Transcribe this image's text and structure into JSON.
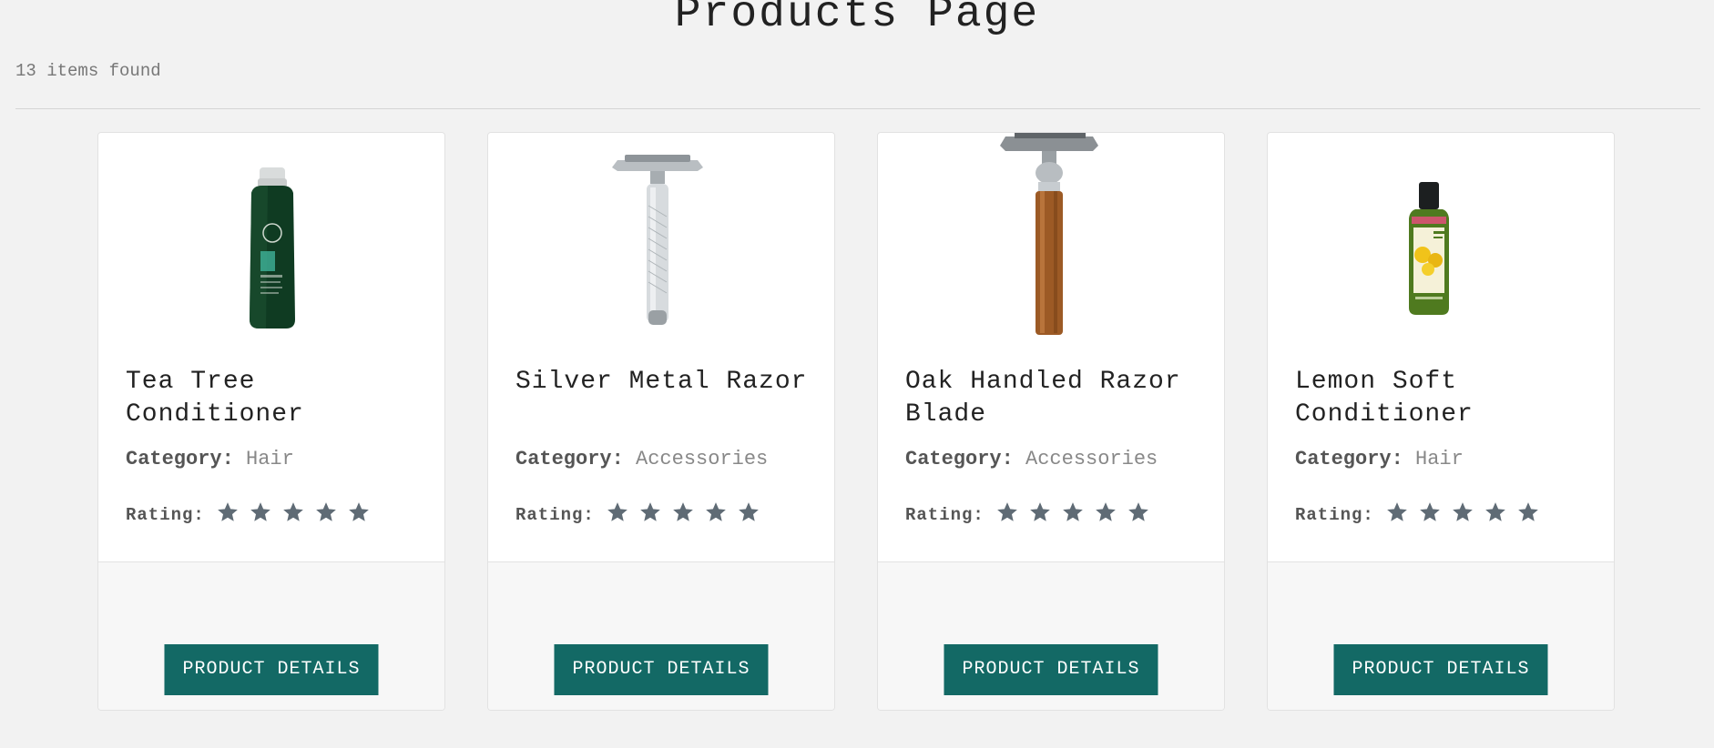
{
  "header": {
    "title": "Products Page",
    "items_found": "13 items found"
  },
  "labels": {
    "category": "Category:",
    "rating": "Rating:",
    "button": "PRODUCT DETAILS"
  },
  "colors": {
    "button_bg": "#136965",
    "star": "#5f6b75"
  },
  "products": [
    {
      "title": "Tea Tree Conditioner",
      "category": "Hair",
      "rating": 5,
      "image": "green-conditioner-bottle"
    },
    {
      "title": "Silver Metal Razor",
      "category": "Accessories",
      "rating": 5,
      "image": "silver-safety-razor"
    },
    {
      "title": "Oak Handled Razor Blade",
      "category": "Accessories",
      "rating": 5,
      "image": "oak-handled-razor"
    },
    {
      "title": "Lemon Soft Conditioner",
      "category": "Hair",
      "rating": 5,
      "image": "lemon-conditioner-bottle"
    }
  ]
}
